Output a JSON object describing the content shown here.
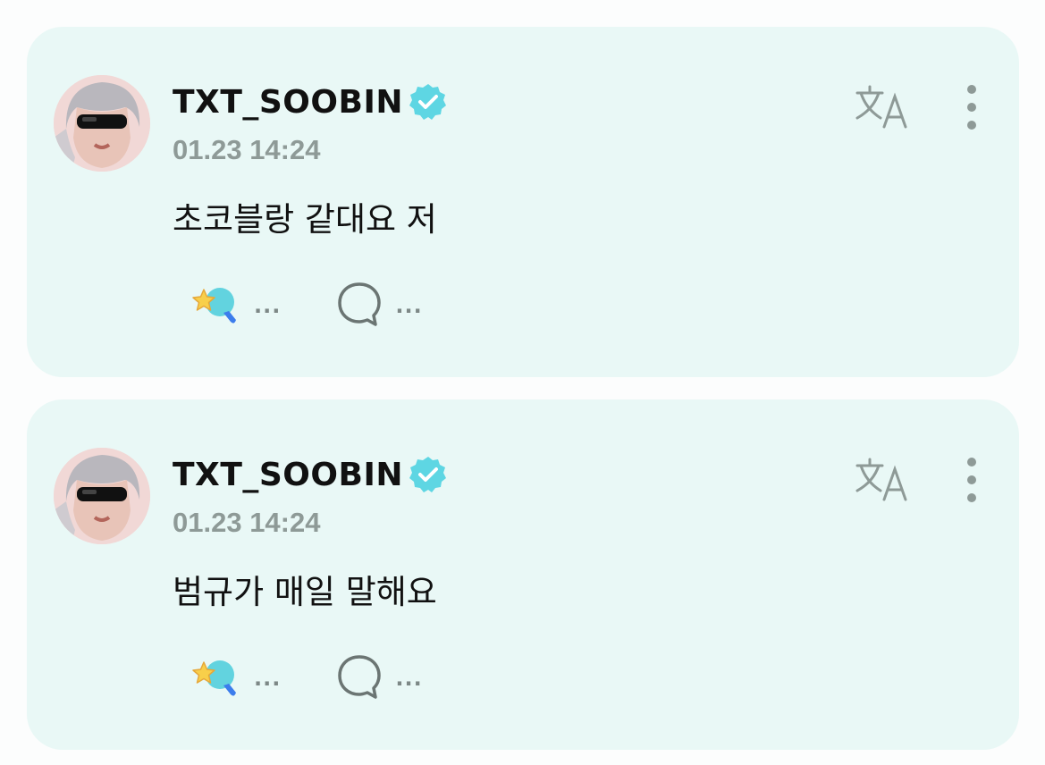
{
  "posts": [
    {
      "username": "TXT_SOOBIN",
      "timestamp": "01.23 14:24",
      "text": "초코블랑 같대요 저",
      "reaction_count": "...",
      "comment_count": "..."
    },
    {
      "username": "TXT_SOOBIN",
      "timestamp": "01.23 14:24",
      "text": "범규가 매일 말해요",
      "reaction_count": "...",
      "comment_count": "..."
    }
  ],
  "icons": {
    "verified": "verified-badge-icon",
    "translate": "translate-icon",
    "more": "more-vertical-icon",
    "reaction": "star-wand-reaction-icon",
    "comment": "comment-bubble-icon"
  },
  "colors": {
    "card_background": "#e9f8f6",
    "verified_badge": "#5ed6e3",
    "icon_gray": "#8e9a97",
    "text": "#111111"
  }
}
